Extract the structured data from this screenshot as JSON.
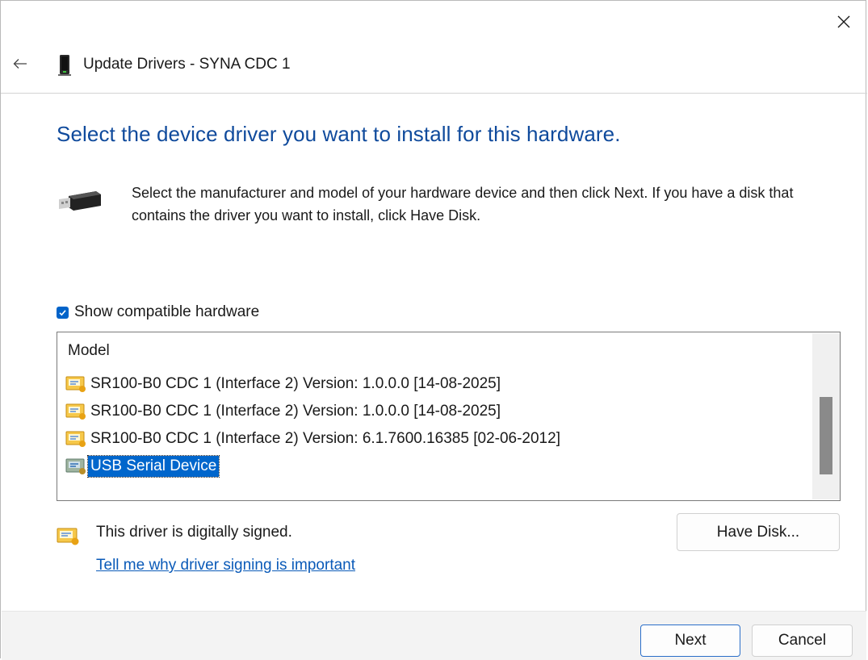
{
  "window": {
    "title": "Update Drivers - SYNA CDC 1",
    "close_icon": "close-icon",
    "back_icon": "back-arrow-icon"
  },
  "main": {
    "heading": "Select the device driver you want to install for this hardware.",
    "instructions": "Select the manufacturer and model of your hardware device and then click Next. If you have a disk that contains the driver you want to install, click Have Disk.",
    "show_compatible": {
      "label": "Show compatible hardware",
      "checked": true
    },
    "model_list": {
      "header": "Model",
      "items": [
        {
          "label": "SR100-B0 CDC 1 (Interface 2) Version: 1.0.0.0 [14-08-2025]",
          "selected": false
        },
        {
          "label": "SR100-B0 CDC 1 (Interface 2) Version: 1.0.0.0 [14-08-2025]",
          "selected": false
        },
        {
          "label": "SR100-B0 CDC 1 (Interface 2) Version: 6.1.7600.16385 [02-06-2012]",
          "selected": false
        },
        {
          "label": "USB Serial Device",
          "selected": true
        }
      ]
    },
    "signed_text": "This driver is digitally signed.",
    "signing_link": "Tell me why driver signing is important",
    "have_disk_label": "Have Disk..."
  },
  "footer": {
    "next_label": "Next",
    "cancel_label": "Cancel"
  },
  "colors": {
    "heading": "#0f4a9c",
    "accent": "#0063c9",
    "selection": "#0066cc",
    "link": "#0a5ab8"
  }
}
